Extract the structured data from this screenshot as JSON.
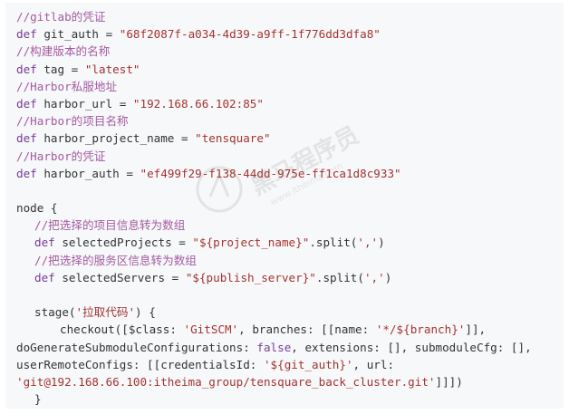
{
  "lines": [
    {
      "indent": 0,
      "parts": [
        {
          "t": "c",
          "s": "//gitlab的凭证"
        }
      ]
    },
    {
      "indent": 0,
      "parts": [
        {
          "t": "k",
          "s": "def"
        },
        {
          "t": "v",
          "s": " git_auth = "
        },
        {
          "t": "s",
          "s": "\"68f2087f-a034-4d39-a9ff-1f776dd3dfa8\""
        }
      ]
    },
    {
      "indent": 0,
      "parts": [
        {
          "t": "c",
          "s": "//构建版本的名称"
        }
      ]
    },
    {
      "indent": 0,
      "parts": [
        {
          "t": "k",
          "s": "def"
        },
        {
          "t": "v",
          "s": " tag = "
        },
        {
          "t": "s",
          "s": "\"latest\""
        }
      ]
    },
    {
      "indent": 0,
      "parts": [
        {
          "t": "c",
          "s": "//Harbor私服地址"
        }
      ]
    },
    {
      "indent": 0,
      "parts": [
        {
          "t": "k",
          "s": "def"
        },
        {
          "t": "v",
          "s": " harbor_url = "
        },
        {
          "t": "s",
          "s": "\"192.168.66.102:85\""
        }
      ]
    },
    {
      "indent": 0,
      "parts": [
        {
          "t": "c",
          "s": "//Harbor的项目名称"
        }
      ]
    },
    {
      "indent": 0,
      "parts": [
        {
          "t": "k",
          "s": "def"
        },
        {
          "t": "v",
          "s": " harbor_project_name = "
        },
        {
          "t": "s",
          "s": "\"tensquare\""
        }
      ]
    },
    {
      "indent": 0,
      "parts": [
        {
          "t": "c",
          "s": "//Harbor的凭证"
        }
      ]
    },
    {
      "indent": 0,
      "parts": [
        {
          "t": "k",
          "s": "def"
        },
        {
          "t": "v",
          "s": " harbor_auth = "
        },
        {
          "t": "s",
          "s": "\"ef499f29-f138-44dd-975e-ff1ca1d8c933\""
        }
      ]
    },
    {
      "indent": 0,
      "parts": []
    },
    {
      "indent": 0,
      "parts": [
        {
          "t": "v",
          "s": "node {"
        }
      ]
    },
    {
      "indent": 1,
      "parts": [
        {
          "t": "c",
          "s": "//把选择的项目信息转为数组"
        }
      ]
    },
    {
      "indent": 1,
      "parts": [
        {
          "t": "k",
          "s": "def"
        },
        {
          "t": "v",
          "s": " selectedProjects = "
        },
        {
          "t": "s",
          "s": "\"${project_name}\""
        },
        {
          "t": "v",
          "s": ".split("
        },
        {
          "t": "s",
          "s": "','"
        },
        {
          "t": "v",
          "s": ")"
        }
      ]
    },
    {
      "indent": 1,
      "parts": [
        {
          "t": "c",
          "s": "//把选择的服务区信息转为数组"
        }
      ]
    },
    {
      "indent": 1,
      "parts": [
        {
          "t": "k",
          "s": "def"
        },
        {
          "t": "v",
          "s": " selectedServers = "
        },
        {
          "t": "s",
          "s": "\"${publish_server}\""
        },
        {
          "t": "v",
          "s": ".split("
        },
        {
          "t": "s",
          "s": "','"
        },
        {
          "t": "v",
          "s": ")"
        }
      ]
    },
    {
      "indent": 0,
      "parts": []
    },
    {
      "indent": 1,
      "parts": [
        {
          "t": "v",
          "s": "stage("
        },
        {
          "t": "s",
          "s": "'拉取代码'"
        },
        {
          "t": "v",
          "s": ") {"
        }
      ]
    },
    {
      "indent": 2,
      "parts": [
        {
          "t": "v",
          "s": "checkout([$class: "
        },
        {
          "t": "s",
          "s": "'GitSCM'"
        },
        {
          "t": "v",
          "s": ", branches: [[name: "
        },
        {
          "t": "s",
          "s": "'*/${branch}'"
        },
        {
          "t": "v",
          "s": "]],"
        }
      ]
    },
    {
      "indent": 0,
      "parts": [
        {
          "t": "v",
          "s": "doGenerateSubmoduleConfigurations: "
        },
        {
          "t": "kw-false",
          "s": "false"
        },
        {
          "t": "v",
          "s": ", extensions: [], submoduleCfg: [],"
        }
      ]
    },
    {
      "indent": 0,
      "parts": [
        {
          "t": "v",
          "s": "userRemoteConfigs: [[credentialsId: "
        },
        {
          "t": "s",
          "s": "'${git_auth}'"
        },
        {
          "t": "v",
          "s": ", url:"
        }
      ]
    },
    {
      "indent": 0,
      "parts": [
        {
          "t": "s",
          "s": "'git@192.168.66.100:itheima_group/tensquare_back_cluster.git'"
        },
        {
          "t": "v",
          "s": "]]])"
        }
      ]
    },
    {
      "indent": 1,
      "parts": [
        {
          "t": "v",
          "s": "}"
        }
      ]
    }
  ],
  "watermark": {
    "text": "黑马程序员",
    "subtext": "www.itheima.com"
  }
}
